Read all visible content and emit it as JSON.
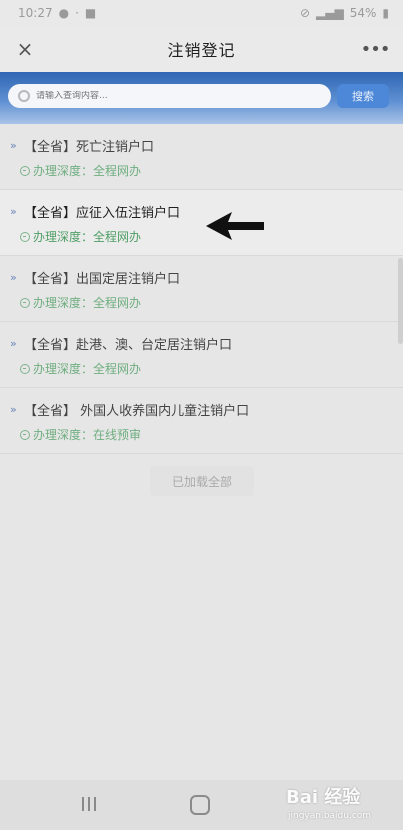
{
  "status_bar": {
    "time": "10:27",
    "battery": "54%"
  },
  "header": {
    "title": "注销登记",
    "close_icon": "×",
    "more_icon": "•••"
  },
  "search": {
    "placeholder": "请输入查询内容...",
    "button_label": "搜索"
  },
  "list": {
    "items": [
      {
        "name": "【全省】死亡注销户口",
        "depth": "办理深度：全程网办"
      },
      {
        "name": "【全省】应征入伍注销户口",
        "depth": "办理深度：全程网办"
      },
      {
        "name": "【全省】出国定居注销户口",
        "depth": "办理深度：全程网办"
      },
      {
        "name": "【全省】赴港、澳、台定居注销户口",
        "depth": "办理深度：全程网办"
      },
      {
        "name": "【全省】 外国人收养国内儿童注销户口",
        "depth": "办理深度：在线预审"
      }
    ],
    "chevron": "»",
    "footer": "已加载全部"
  },
  "watermark": {
    "brand": "Bai  经验",
    "url": "jingyan.baidu.com"
  },
  "colors": {
    "accent_blue": "#2f66b3",
    "depth_green": "#6fae80"
  }
}
